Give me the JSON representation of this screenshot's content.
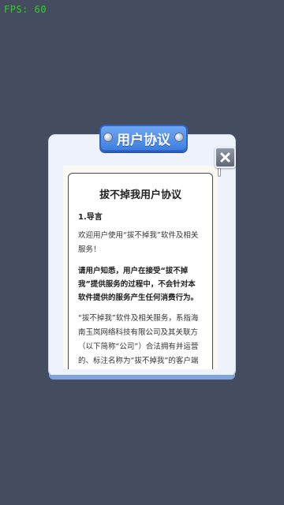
{
  "fps_label": "FPS: 60",
  "dialog": {
    "title": "用户协议",
    "close_icon": "close-x-icon",
    "document": {
      "title": "拔不掉我用户协议",
      "section_heading": "1.导言",
      "welcome": "欢迎用户使用“拔不掉我”软件及相关服务！",
      "notice": "请用户知悉，用户在接受“拔不掉我”提供服务的过程中，不会针对本软件提供的服务产生任何消费行为。",
      "definition": "“拔不掉我”软件及相关服务，系指海南玉岚网络科技有限公司及其关联方（以下简称“公司”）合法拥有并运营的、标注名称为“拔不掉我”的客户端应用程序（同时含其简化版等不同版本）以及公司官方网站，向用户提供的产品与服务，包括但不"
    }
  },
  "colors": {
    "background": "#434d5f",
    "fps_text": "#2fd11f",
    "banner": "#3f7fe0",
    "dialog": "#eef3fb"
  }
}
